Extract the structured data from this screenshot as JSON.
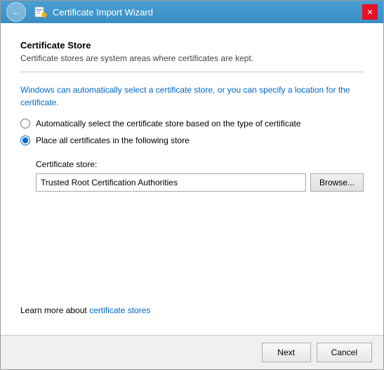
{
  "window": {
    "title": "Certificate Import Wizard",
    "back_button_label": "←",
    "close_button_label": "✕"
  },
  "content": {
    "section_title": "Certificate Store",
    "section_desc": "Certificate stores are system areas where certificates are kept.",
    "info_text_part1": "Windows can automatically select a certificate store, or you can specify a location for the certificate.",
    "radio_auto_label": "Automatically select the certificate store based on the type of certificate",
    "radio_manual_label": "Place all certificates in the following store",
    "store_label": "Certificate store:",
    "store_value": "Trusted Root Certification Authorities",
    "browse_label": "Browse...",
    "learn_more_prefix": "Learn more about ",
    "learn_more_link": "certificate stores",
    "next_label": "Next",
    "cancel_label": "Cancel"
  }
}
